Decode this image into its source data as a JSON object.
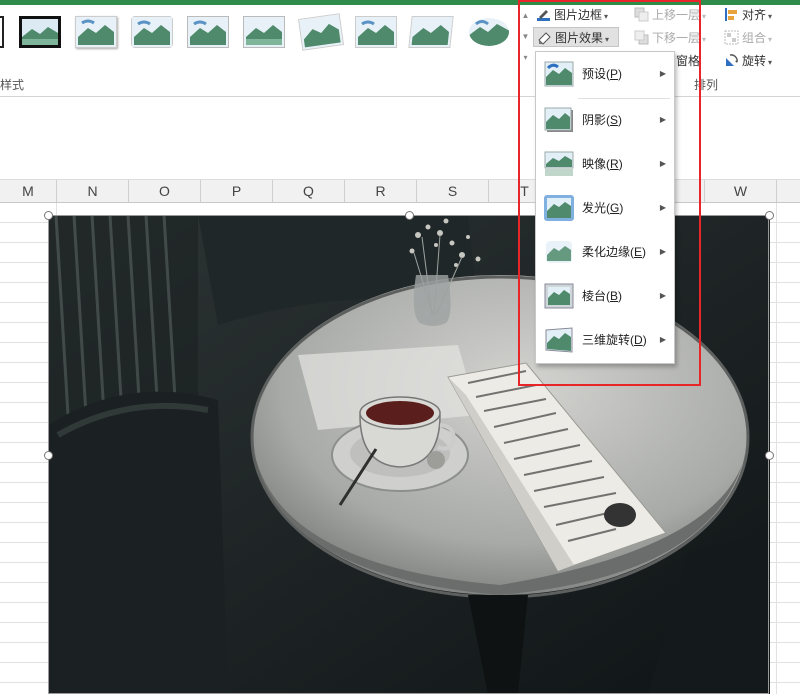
{
  "ribbon": {
    "accent": "#2e8b4a",
    "group_styles_label": "样式",
    "group_arrange_label": "排列",
    "picture_border": "图片边框",
    "picture_effects": "图片效果",
    "bring_forward": "上移一层",
    "send_backward": "下移一层",
    "selection_pane_partial": "窗格",
    "align": "对齐",
    "group": "组合",
    "rotate": "旋转"
  },
  "columns": [
    "M",
    "N",
    "O",
    "P",
    "Q",
    "R",
    "S",
    "T",
    "W"
  ],
  "effects_menu": {
    "items": [
      {
        "label": "预设",
        "key": "P",
        "icon": "preset-icon"
      },
      {
        "label": "阴影",
        "key": "S",
        "icon": "shadow-icon"
      },
      {
        "label": "映像",
        "key": "R",
        "icon": "reflection-icon"
      },
      {
        "label": "发光",
        "key": "G",
        "icon": "glow-icon"
      },
      {
        "label": "柔化边缘",
        "key": "E",
        "icon": "soft-edges-icon"
      },
      {
        "label": "棱台",
        "key": "B",
        "icon": "bevel-icon"
      },
      {
        "label": "三维旋转",
        "key": "D",
        "icon": "3d-rotation-icon"
      }
    ]
  },
  "highlight_color": "#e8262a"
}
